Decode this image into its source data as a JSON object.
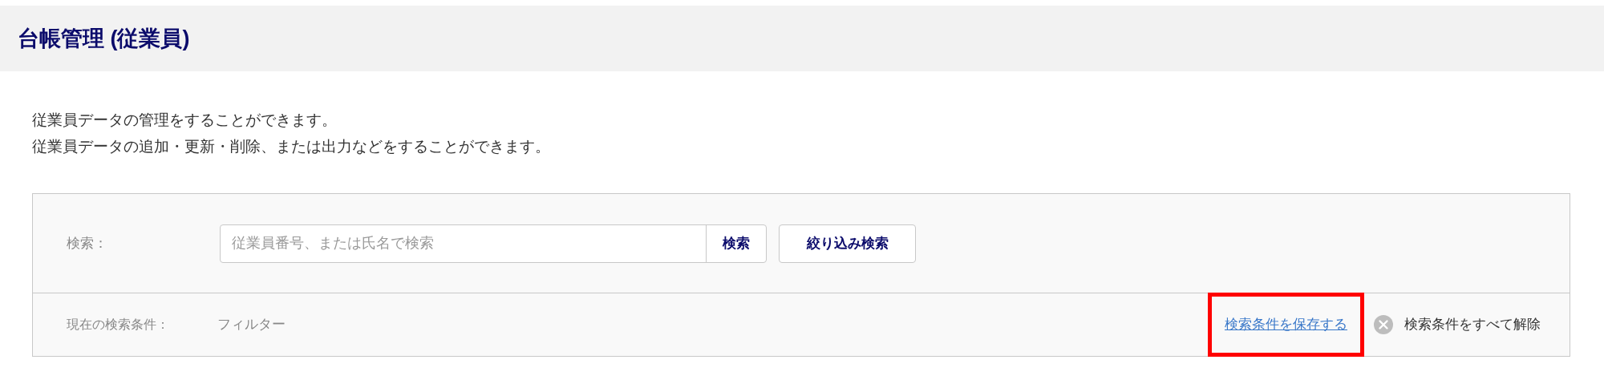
{
  "header": {
    "title": "台帳管理 (従業員)"
  },
  "description": [
    "従業員データの管理をすることができます。",
    "従業員データの追加・更新・削除、または出力などをすることができます。"
  ],
  "search": {
    "label": "検索：",
    "placeholder": "従業員番号、または氏名で検索",
    "search_button": "検索",
    "filter_button": "絞り込み検索"
  },
  "conditions": {
    "label": "現在の検索条件：",
    "value": "フィルター",
    "save_link": {
      "text": "検索条件を保存する",
      "highlighted": true
    },
    "clear_all": "検索条件をすべて解除"
  }
}
